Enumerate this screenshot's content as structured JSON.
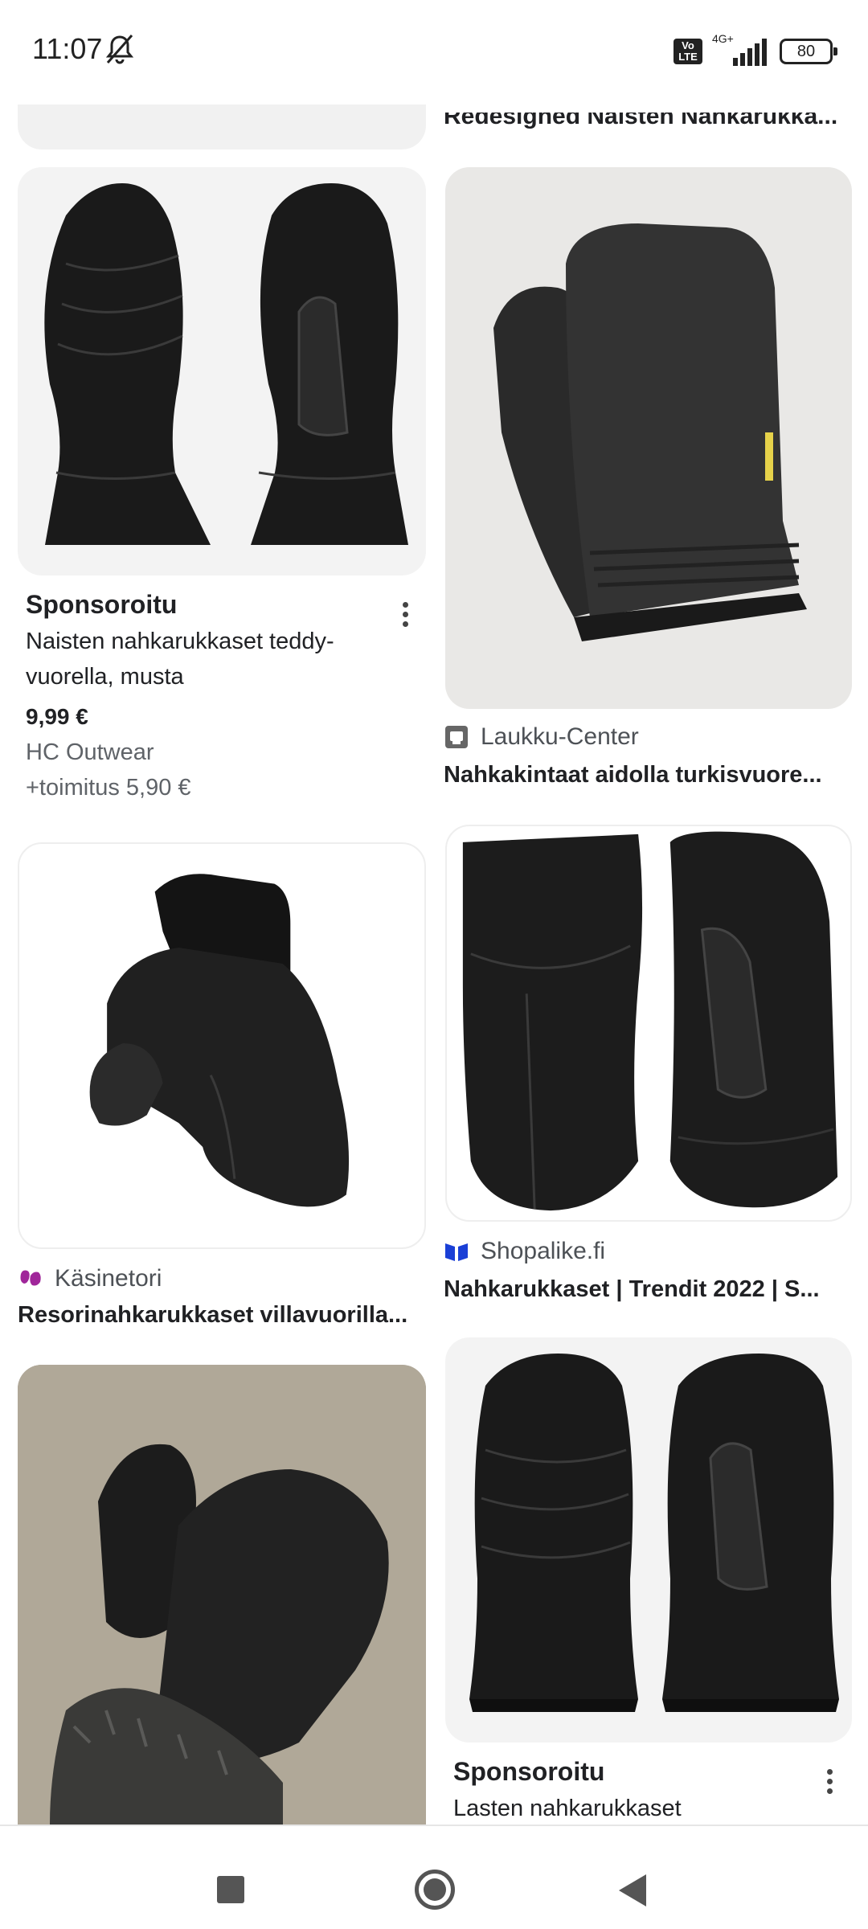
{
  "status_bar": {
    "time": "11:07",
    "network_type": "4G+",
    "volte": "Vo LTE",
    "battery": "80"
  },
  "peek": {
    "right_title": "Redesigned Naisten Nahkarukka..."
  },
  "cards": [
    {
      "sponsored_label": "Sponsoroitu",
      "title_line1": "Naisten nahkarukkaset teddy-",
      "title_line2": "vuorella, musta",
      "price": "9,99 €",
      "seller": "HC Outwear",
      "shipping": "+toimitus 5,90 €"
    },
    {
      "source": "Laukku-Center",
      "title": "Nahkakintaat aidolla turkisvuore..."
    },
    {
      "source": "Käsinetori",
      "title": "Resorinahkarukkaset villavuorilla..."
    },
    {
      "source": "Shopalike.fi",
      "title": "Nahkarukkaset | Trendit 2022 | S..."
    },
    {
      "sponsored_label": "Sponsoroitu",
      "title": "Lasten nahkarukkaset"
    }
  ],
  "colors": {
    "accent_blue": "#1a3fd6",
    "kasinetori_purple": "#a0269a",
    "text": "#202124",
    "muted": "#5f6368"
  }
}
